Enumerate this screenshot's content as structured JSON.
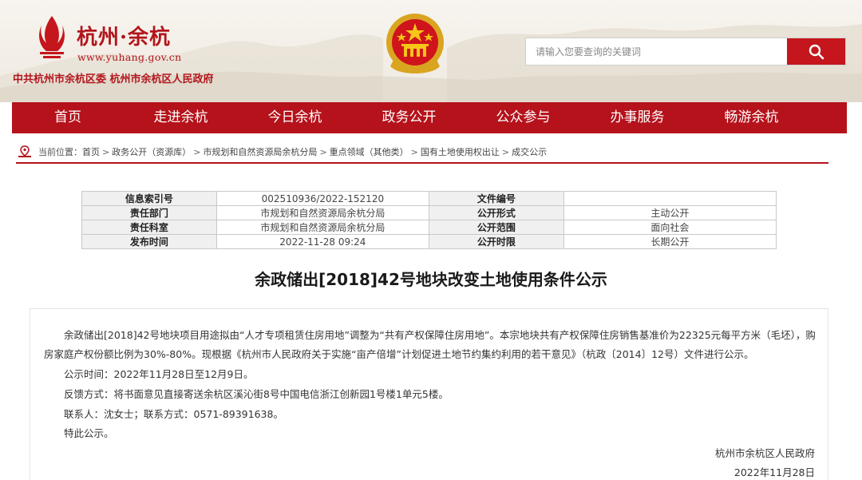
{
  "header": {
    "logo_title": "杭州·余杭",
    "logo_url": "www.yuhang.gov.cn",
    "org_name": "中共杭州市余杭区委  杭州市余杭区人民政府",
    "search_placeholder": "请输入您要查询的关键词",
    "search_icon": "search-icon"
  },
  "nav": {
    "items": [
      "首页",
      "走进余杭",
      "今日余杭",
      "政务公开",
      "公众参与",
      "办事服务",
      "畅游余杭"
    ]
  },
  "breadcrumb": {
    "label": "当前位置：",
    "items": [
      "首页",
      "政务公开（资源库）",
      "市规划和自然资源局余杭分局",
      "重点领域（其他类）",
      "国有土地使用权出让",
      "成交公示"
    ]
  },
  "info": {
    "rows": [
      [
        "信息索引号",
        "002510936/2022-152120",
        "文件编号",
        ""
      ],
      [
        "责任部门",
        "市规划和自然资源局余杭分局",
        "公开形式",
        "主动公开"
      ],
      [
        "责任科室",
        "市规划和自然资源局余杭分局",
        "公开范围",
        "面向社会"
      ],
      [
        "发布时间",
        "2022-11-28 09:24",
        "公开时限",
        "长期公开"
      ]
    ]
  },
  "article": {
    "title": "余政储出[2018]42号地块改变土地使用条件公示",
    "p1_line1": "余政储出[2018]42号地块项目用途拟由“人才专项租赁住房用地”调整为“共有产权保障住房用地”。本宗地块共有产权保障住房销售基准价为22325元每平方米（毛坯），购",
    "p1_line2": "房家庭产权份额比例为30%-80%。现根据《杭州市人民政府关于实施“亩产倍增”计划促进土地节约集约利用的若干意见》（杭政〔2014〕12号）文件进行公示。",
    "p2": "公示时间：2022年11月28日至12月9日。",
    "p3": "反馈方式：将书面意见直接寄送余杭区溪沁街8号中国电信浙江创新园1号楼1单元5楼。",
    "p4": "联系人：沈女士；联系方式：0571-89391638。",
    "p5": "特此公示。",
    "signature": "杭州市余杭区人民政府",
    "date": "2022年11月28日"
  },
  "colors": {
    "brand_red": "#b5121b",
    "search_red": "#c4161c"
  }
}
